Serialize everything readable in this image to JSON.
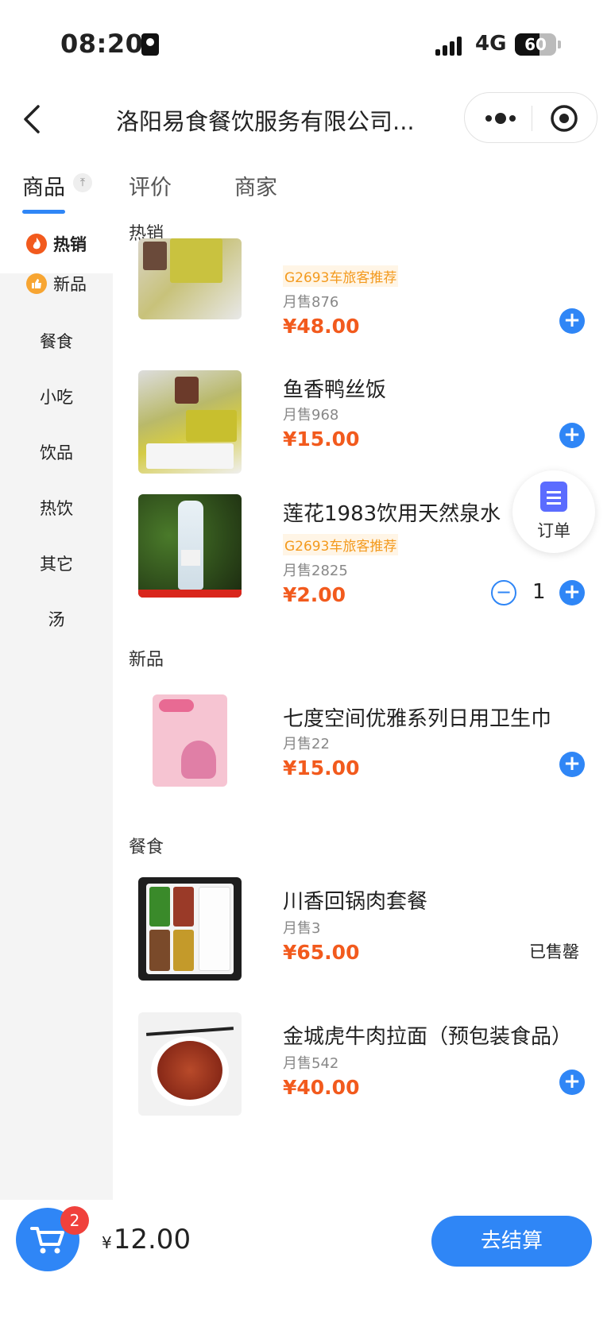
{
  "status_bar": {
    "time": "08:20",
    "network": "4G",
    "battery": "60",
    "battery_level": 0.6
  },
  "header": {
    "title": "洛阳易食餐饮服务有限公司..."
  },
  "tabs": [
    {
      "label": "商品"
    },
    {
      "label": "评价"
    },
    {
      "label": "商家"
    }
  ],
  "sidebar": {
    "categories": [
      {
        "label": "热销",
        "icon": "fire-icon"
      },
      {
        "label": "新品",
        "icon": "thumbs-up-icon"
      },
      {
        "label": "餐食"
      },
      {
        "label": "小吃"
      },
      {
        "label": "饮品"
      },
      {
        "label": "热饮"
      },
      {
        "label": "其它"
      },
      {
        "label": "汤"
      }
    ]
  },
  "sections": {
    "hot": "热销",
    "new": "新品",
    "meals": "餐食"
  },
  "products": [
    {
      "name": "",
      "tag": "G2693车旅客推荐",
      "sold": "月售876",
      "price": "¥48.00"
    },
    {
      "name": "鱼香鸭丝饭",
      "sold": "月售968",
      "price": "¥15.00"
    },
    {
      "name": "莲花1983饮用天然泉水",
      "tag": "G2693车旅客推荐",
      "sold": "月售2825",
      "price": "¥2.00",
      "quantity": "1"
    },
    {
      "name": "七度空间优雅系列日用卫生巾",
      "sold": "月售22",
      "price": "¥15.00"
    },
    {
      "name": "川香回锅肉套餐",
      "sold": "月售3",
      "price": "¥65.00",
      "status": "已售罄"
    },
    {
      "name": "金城虎牛肉拉面（预包装食品）",
      "sold": "月售542",
      "price": "¥40.00"
    }
  ],
  "order_float": {
    "label": "订单"
  },
  "cart": {
    "count": "2",
    "currency": "¥",
    "total": "12.00",
    "checkout_label": "去结算"
  },
  "colors": {
    "accent": "#2f86f6",
    "price": "#f25a1d",
    "tag": "#f39a1e",
    "badge": "#f0413c"
  }
}
